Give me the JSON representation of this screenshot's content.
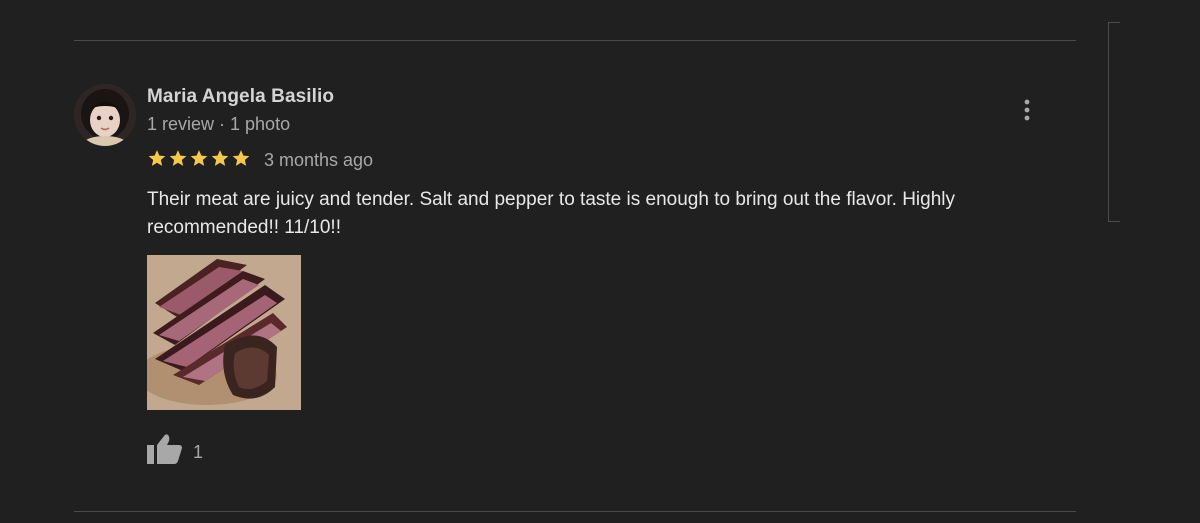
{
  "review": {
    "reviewer_name": "Maria Angela Basilio",
    "reviewer_meta": "1 review · 1 photo",
    "rating": 5,
    "rating_max": 5,
    "time_ago": "3 months ago",
    "text": "Their meat are juicy and tender. Salt and pepper to taste is enough to bring out the flavor. Highly recommended!! 11/10!!",
    "like_count": "1"
  },
  "icons": {
    "star": "star-icon",
    "like": "thumbs-up-icon",
    "more": "more-vert-icon"
  },
  "colors": {
    "background": "#202020",
    "star": "#f4c84a",
    "name": "#d4d4d4",
    "meta": "#a8a8a8",
    "body_text": "#e8e8e8"
  }
}
